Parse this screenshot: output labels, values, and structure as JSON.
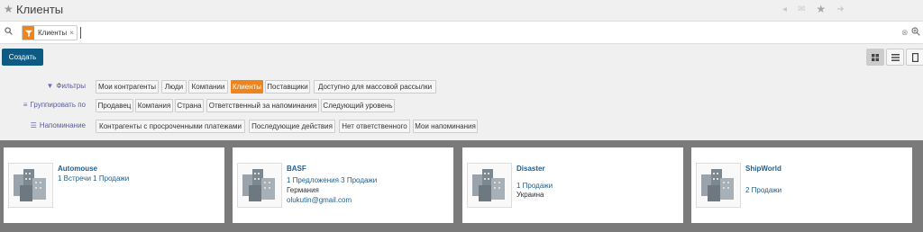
{
  "header": {
    "title": "Клиенты"
  },
  "search": {
    "facet_label": "Клиенты",
    "facet_close": "×"
  },
  "actions": {
    "create_label": "Создать"
  },
  "views": [
    "kanban",
    "list",
    "form"
  ],
  "filters": {
    "filter_label": "Фильтры",
    "groupby_label": "Группировать по",
    "reminder_label": "Напоминание",
    "filter_items": [
      {
        "label": "Мои контрагенты",
        "active": false
      },
      {
        "label": "Люди",
        "active": false
      },
      {
        "label": "Компании",
        "active": false
      },
      {
        "label": "Клиенты",
        "active": true
      },
      {
        "label": "Поставщики",
        "active": false
      },
      {
        "label": "Доступно для массовой рассылки",
        "active": false
      }
    ],
    "groupby_items": [
      {
        "label": "Продавец"
      },
      {
        "label": "Компания"
      },
      {
        "label": "Страна"
      },
      {
        "label": "Ответственный за напоминания"
      },
      {
        "label": "Следующий уровень"
      }
    ],
    "reminder_items": [
      {
        "label": "Контрагенты с просроченными платежами"
      },
      {
        "label": "Последующие действия"
      },
      {
        "label": "Нет ответственного"
      },
      {
        "label": "Мои напоминания"
      }
    ]
  },
  "cards": [
    {
      "name": "Automouse",
      "line1": "1 Встречи 1 Продажи",
      "line2": "",
      "line3": ""
    },
    {
      "name": "BASF",
      "line1": "1 Предложения 3 Продажи",
      "line2": "Германия",
      "line3": "olukutin@gmail.com"
    },
    {
      "name": "Disaster",
      "line1": "1 Продажи",
      "line2": "Украина",
      "line3": ""
    },
    {
      "name": "ShipWorld",
      "line1": "2 Продажи",
      "line2": "",
      "line3": ""
    }
  ],
  "colors": {
    "accent": "#f0841c",
    "primary": "#0d5a82",
    "link": "#1f5f8f"
  }
}
